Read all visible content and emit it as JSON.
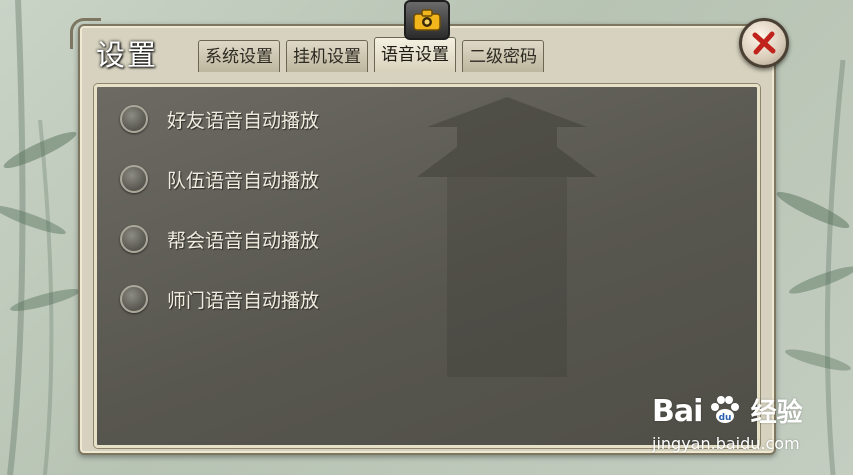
{
  "panel": {
    "title": "设置"
  },
  "tabs": [
    {
      "label": "系统设置",
      "active": false
    },
    {
      "label": "挂机设置",
      "active": false
    },
    {
      "label": "语音设置",
      "active": true
    },
    {
      "label": "二级密码",
      "active": false
    }
  ],
  "options": [
    {
      "label": "好友语音自动播放",
      "checked": false
    },
    {
      "label": "队伍语音自动播放",
      "checked": false
    },
    {
      "label": "帮会语音自动播放",
      "checked": false
    },
    {
      "label": "师门语音自动播放",
      "checked": false
    }
  ],
  "icons": {
    "camera": "camera-icon",
    "close": "close-icon"
  },
  "colors": {
    "accent_close": "#c0231b",
    "camera_lens": "#f2b51c"
  },
  "watermark": {
    "brand": "Bai",
    "brand_cn": "经验",
    "url": "jingyan.baidu.com"
  }
}
